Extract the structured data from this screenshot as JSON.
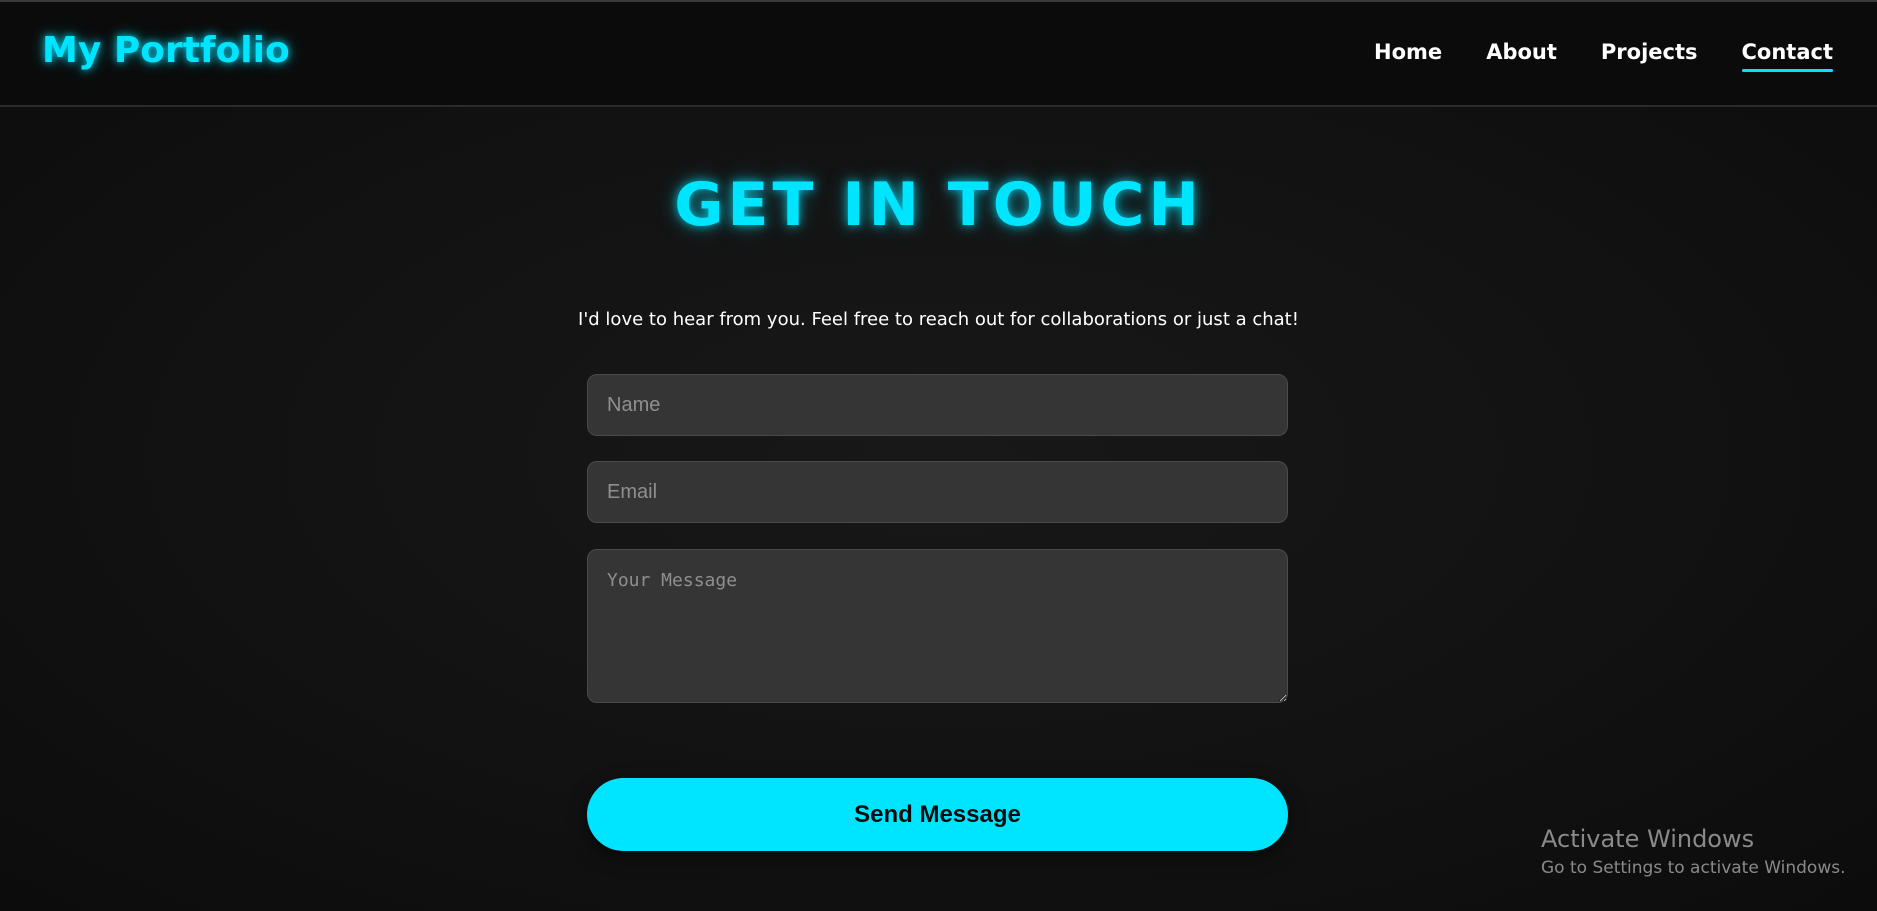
{
  "header": {
    "logo": "My Portfolio",
    "nav": [
      {
        "label": "Home",
        "active": false
      },
      {
        "label": "About",
        "active": false
      },
      {
        "label": "Projects",
        "active": false
      },
      {
        "label": "Contact",
        "active": true
      }
    ]
  },
  "contact": {
    "title": "GET IN TOUCH",
    "subtitle": "I'd love to hear from you. Feel free to reach out for collaborations or just a chat!",
    "form": {
      "name_placeholder": "Name",
      "name_value": "",
      "email_placeholder": "Email",
      "email_value": "",
      "message_placeholder": "Your Message",
      "message_value": "",
      "submit_label": "Send Message"
    }
  },
  "watermark": {
    "title": "Activate Windows",
    "subtitle": "Go to Settings to activate Windows."
  },
  "colors": {
    "accent": "#00e5ff",
    "background": "#111111",
    "field_background": "#353535"
  }
}
